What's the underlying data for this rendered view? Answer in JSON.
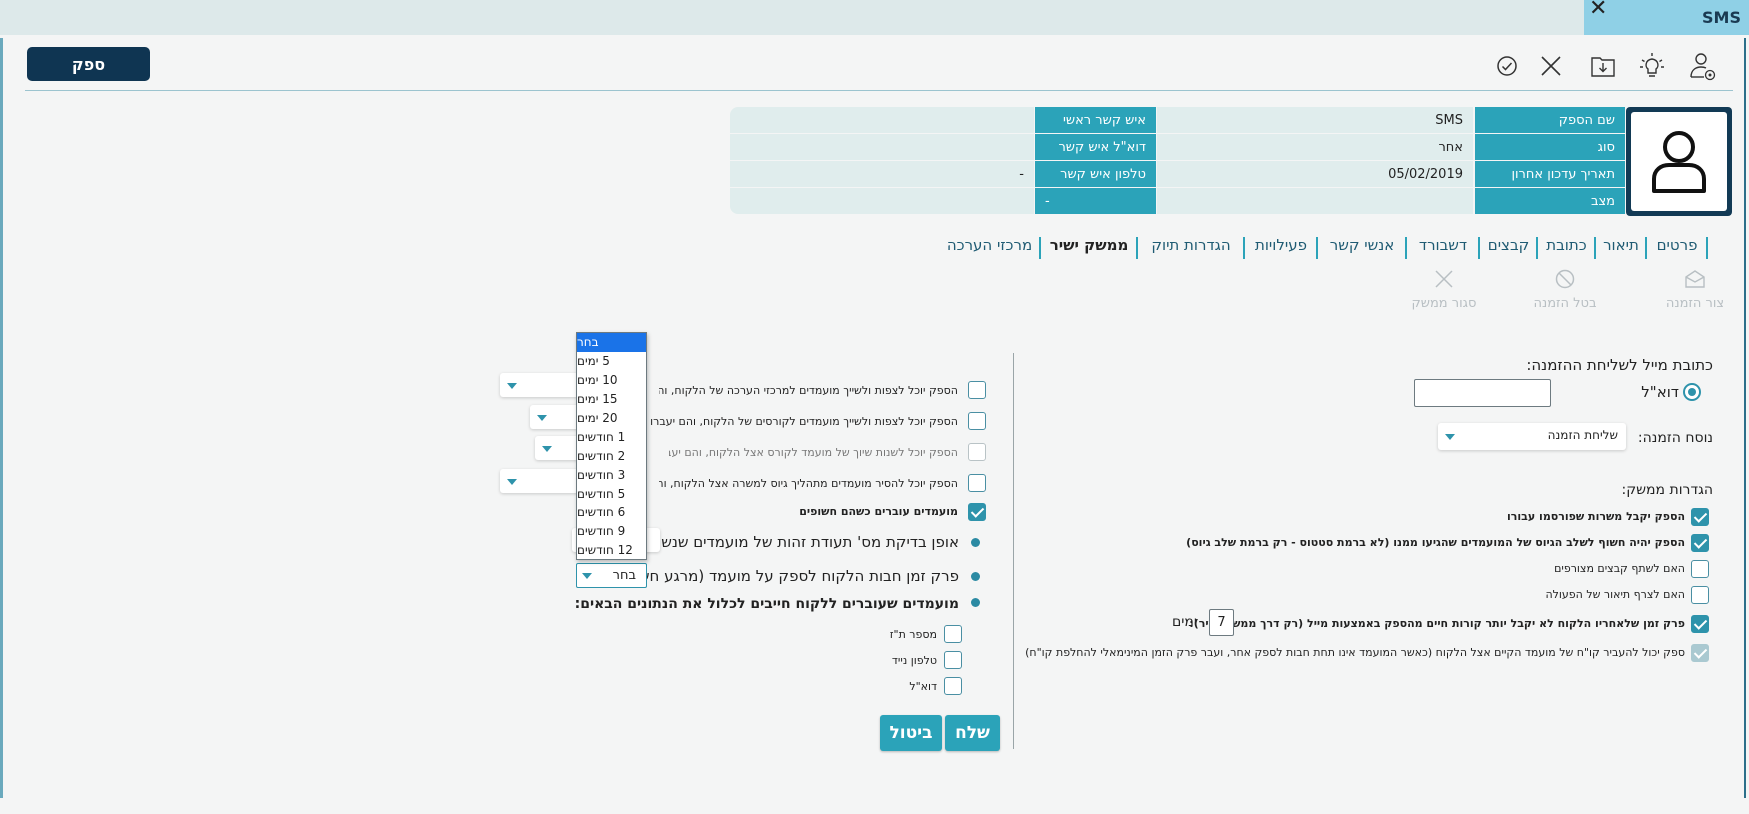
{
  "window_tab": {
    "title": "SMS",
    "close": "✕"
  },
  "toolbar": {
    "supplier_button": "ספק"
  },
  "header": {
    "rows": [
      {
        "label": "שם הספק",
        "value": "SMS",
        "label2": "איש קשר ראשי",
        "value2": ""
      },
      {
        "label": "סוג",
        "value": "אחר",
        "label2": "דוא\"ל איש קשר",
        "value2": ""
      },
      {
        "label": "תאריך עדכון אחרון",
        "value": "05/02/2019",
        "label2": "טלפון איש קשר",
        "value2": "-"
      },
      {
        "label": "מצב",
        "value": "",
        "label2": "",
        "value2": "-"
      }
    ]
  },
  "tabs": [
    "פרטים",
    "תיאור",
    "כתובת",
    "קבצים",
    "דשבורד",
    "אנשי קשר",
    "פעילויות",
    "הגדרות תיוק",
    "ממשק ישיר",
    "מרכזי הערכה"
  ],
  "actions": {
    "create": "צור הזמנה",
    "cancel": "בטל הזמנה",
    "close_iface": "סגור ממשק"
  },
  "right_panel": {
    "email_heading": "כתובת מייל לשליחת ההזמנה:",
    "email_radio_label": "דוא\"ל",
    "email_value": "",
    "version_label": "נוסח הזמנה:",
    "version_value": "שליחת הזמנה",
    "settings_heading": "הגדרות ממשק:",
    "settings": [
      "הספק יקבל משרות שפורסמו עבורו",
      "הספק יהיה חשוף לשלב הגיוס של המועמדים שהגיעו ממנו (לא ברמת סטטוס - רק ברמת שלב גיוס)",
      "האם לשתף קבצים מצורפים",
      "האם לצרף תיאור של הפעולה",
      "פרק זמן שלאחריו הלקוח לא יקבל יותר קורות חיים מהספק באמצעות מייל (רק דרך ממשק ישיר):",
      "ספק יכול להעביר קו\"ח של מועמד הקיים אצל הלקוח (כאשר המועמד אינו תחת חבות לספק אחר, ועבר פרק הזמן המינימאלי להחלפת קו\"ח)"
    ],
    "days_value": "7",
    "days_label": "ימים"
  },
  "left_panel": {
    "checks": [
      "הספק יוכל לצפות ולשייך מועמדים למרכזי הערכה של הלקוח, והם יעברו ל",
      "הספק יוכל לצפות ולשייך מועמדים לקורסים של הלקוח, והם יעברו למצב:",
      "הספק יוכל לשנות שיוך של מועמד לקורס אצל הלקוח, והם יעברו למצב:",
      "הספק יוכל להסיר מועמדים מתהליך גיוס למשרה אצל הלקוח, והם יעברו ל",
      "מועמדים עוברים כשהם חשופים"
    ],
    "id_method_label": "אופן בדיקת מס' תעודת זהות של מועמדים שנשלחים:",
    "liability_label": "פרק זמן חבות הלקוח לספק על מועמד (מרגע חשיפתו):",
    "liability_value": "בחר",
    "required_heading": "מועמדים שעוברים ללקוח חייבים לכלול את הנתונים הבאים:",
    "required_fields": [
      "מספר ת\"ז",
      "טלפון נייד",
      "דוא\"ל"
    ],
    "send": "שלח",
    "cancel": "ביטול"
  },
  "dropdown": {
    "options": [
      "בחר",
      "5 ימים",
      "10 ימים",
      "15 ימים",
      "20 ימים",
      "1 חודשים",
      "2 חודשים",
      "3 חודשים",
      "5 חודשים",
      "6 חודשים",
      "9 חודשים",
      "12 חודשים"
    ],
    "selected": "בחר"
  },
  "colors": {
    "accent": "#2ba3b9",
    "dark": "#0f3552",
    "checked": "#2e93ab"
  }
}
